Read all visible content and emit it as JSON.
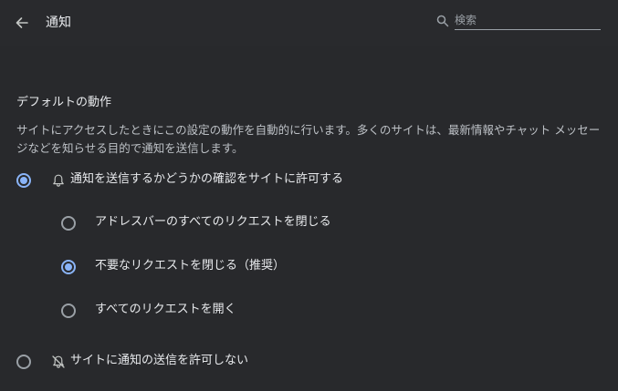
{
  "header": {
    "title": "通知",
    "search": {
      "placeholder": "検索",
      "value": ""
    }
  },
  "section": {
    "title": "デフォルトの動作",
    "description": "サイトにアクセスしたときにこの設定の動作を自動的に行います。多くのサイトは、最新情報やチャット メッセージなどを知らせる目的で通知を送信します。"
  },
  "options": {
    "allow": {
      "label": "通知を送信するかどうかの確認をサイトに許可する",
      "icon": "bell-icon",
      "selected": true
    },
    "sub": [
      {
        "label": "アドレスバーのすべてのリクエストを閉じる",
        "selected": false
      },
      {
        "label": "不要なリクエストを閉じる（推奨）",
        "selected": true
      },
      {
        "label": "すべてのリクエストを開く",
        "selected": false
      }
    ],
    "block": {
      "label": "サイトに通知の送信を許可しない",
      "icon": "bell-off-icon",
      "selected": false
    }
  },
  "colors": {
    "accent": "#8ab4f8",
    "background": "#28292c",
    "header": "#292a2d",
    "text": "#e8eaed",
    "secondary_text": "#bdc1c6"
  }
}
